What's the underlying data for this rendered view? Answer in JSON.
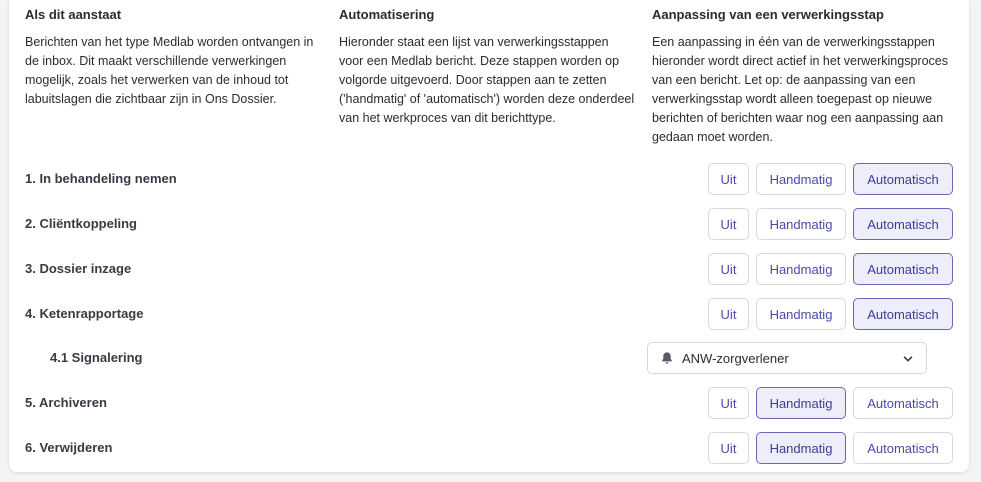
{
  "info": {
    "col1": {
      "title": "Als dit aanstaat",
      "text": "Berichten van het type Medlab worden ontvangen in de inbox. Dit maakt verschillende verwerkingen mogelijk, zoals het verwerken van de inhoud tot labuitslagen die zichtbaar zijn in Ons Dossier."
    },
    "col2": {
      "title": "Automatisering",
      "text": "Hieronder staat een lijst van verwerkingsstappen voor een Medlab bericht. Deze stappen worden op volgorde uitgevoerd. Door stappen aan te zetten ('handmatig' of 'automatisch') worden deze onderdeel van het werkproces van dit berichttype."
    },
    "col3": {
      "title": "Aanpassing van een verwerkingsstap",
      "text": "Een aanpassing in één van de verwerkingsstappen hieronder wordt direct actief in het verwerkingsproces van een bericht. Let op: de aanpassing van een verwerkingsstap wordt alleen toegepast op nieuwe berichten of berichten waar nog een aanpassing aan gedaan moet worden."
    }
  },
  "options": {
    "off": "Uit",
    "manual": "Handmatig",
    "auto": "Automatisch"
  },
  "steps": [
    {
      "label": "1. In behandeling nemen",
      "selected": "auto"
    },
    {
      "label": "2. Cliëntkoppeling",
      "selected": "auto"
    },
    {
      "label": "3. Dossier inzage",
      "selected": "auto"
    },
    {
      "label": "4. Ketenrapportage",
      "selected": "auto"
    },
    {
      "label": "5. Archiveren",
      "selected": "manual"
    },
    {
      "label": "6. Verwijderen",
      "selected": "manual"
    }
  ],
  "substep": {
    "label": "4.1 Signalering",
    "value": "ANW-zorgverlener",
    "icon": "bell-icon"
  },
  "colors": {
    "accent": "#4b4ba8",
    "active_bg": "#eeedfa",
    "active_border": "#6a67b8"
  }
}
